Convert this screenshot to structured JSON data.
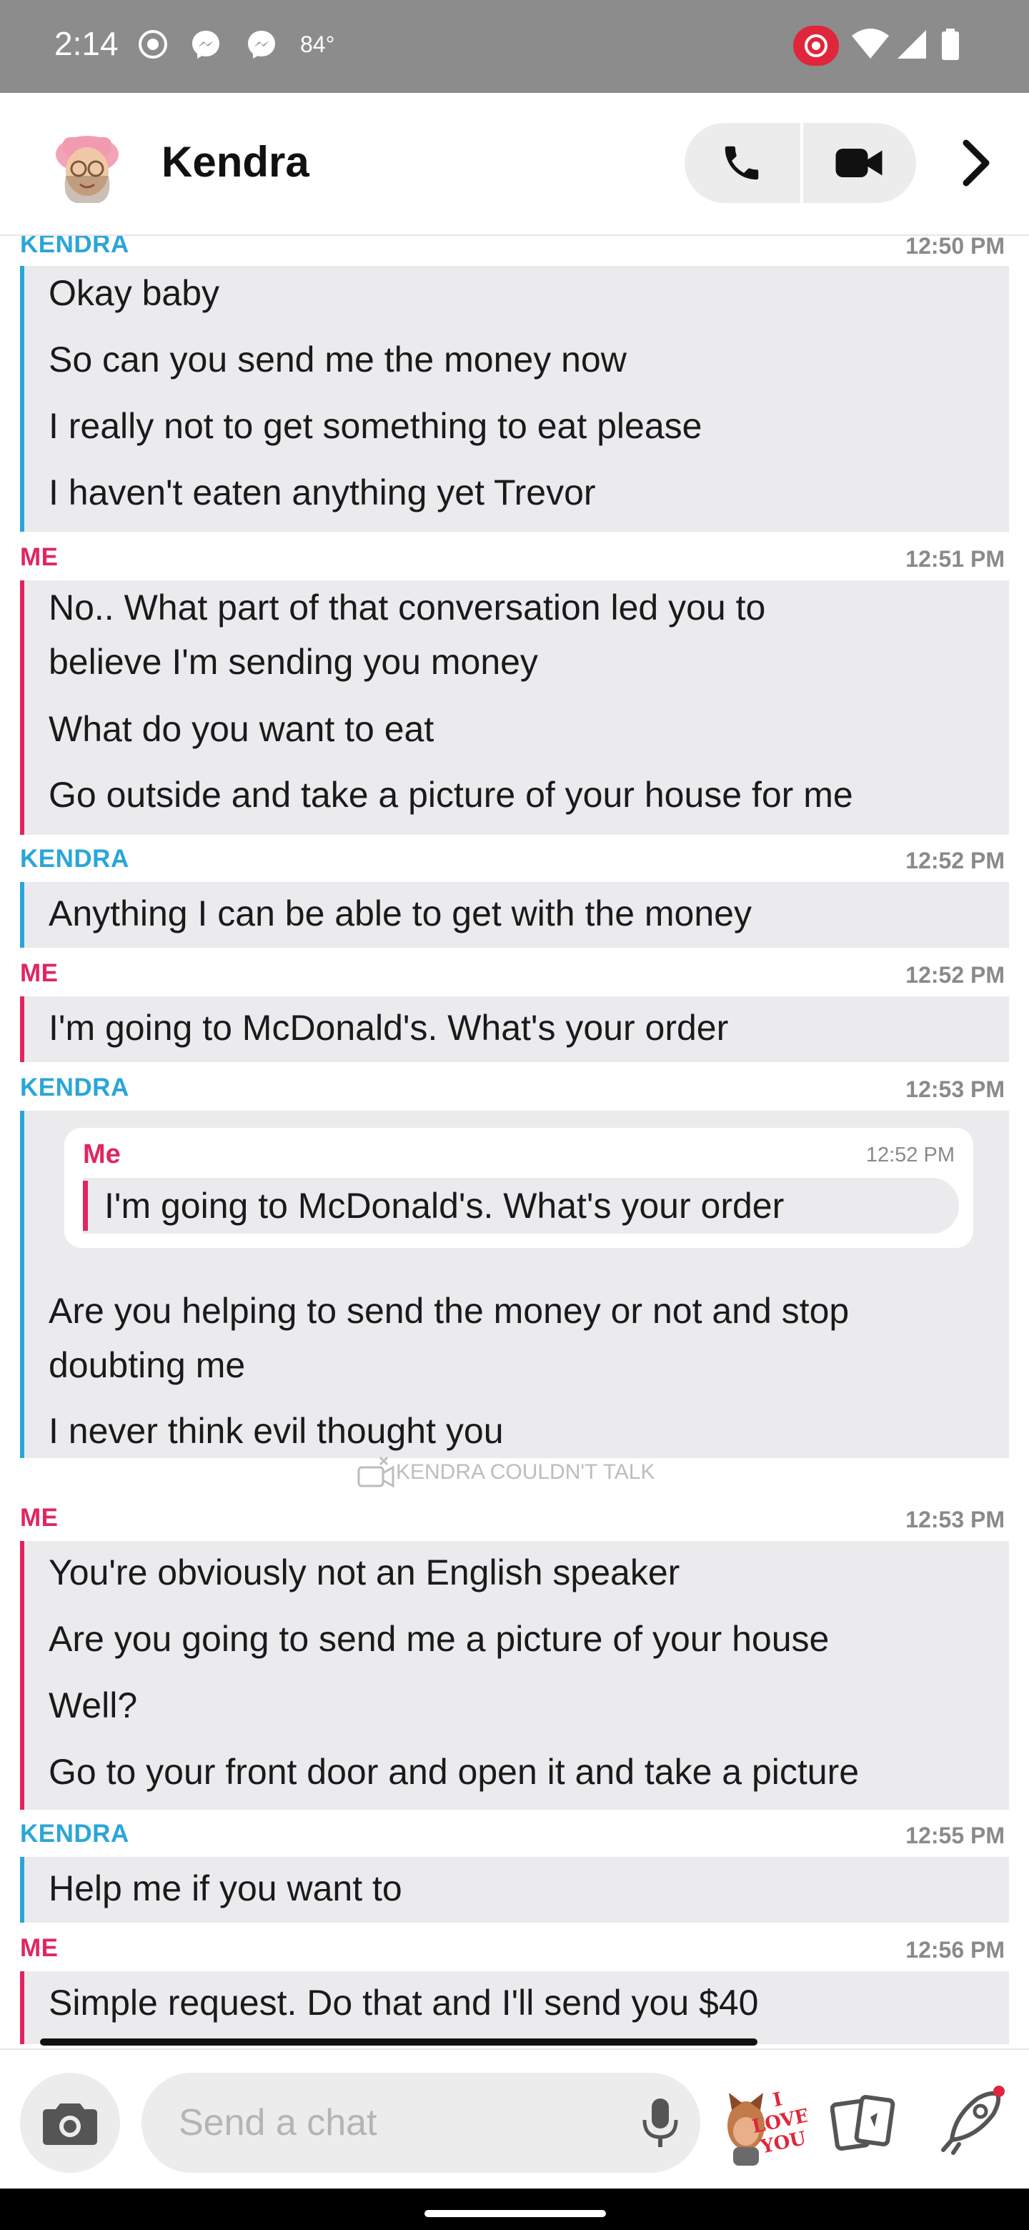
{
  "status_bar": {
    "time": "2:14",
    "temperature": "84°"
  },
  "header": {
    "contact_name": "Kendra"
  },
  "conversation": [
    {
      "sender": "KENDRA",
      "time": "12:50 PM",
      "messages": [
        "Okay baby",
        "So can you send me the money now",
        "I really not to get something to eat please",
        "I haven't eaten anything yet Trevor"
      ]
    },
    {
      "sender": "ME",
      "time": "12:51 PM",
      "messages": [
        "No.. What part of that conversation led you to",
        "believe I'm sending you money",
        "What do you want to eat",
        "Go outside and take a picture of your house for me"
      ]
    },
    {
      "sender": "KENDRA",
      "time": "12:52 PM",
      "messages": [
        "Anything I can be able to get with the money"
      ]
    },
    {
      "sender": "ME",
      "time": "12:52 PM",
      "messages": [
        "I'm going to McDonald's. What's your order"
      ]
    },
    {
      "sender": "KENDRA",
      "time": "12:53 PM",
      "quote": {
        "sender": "Me",
        "time": "12:52 PM",
        "text": "I'm going to McDonald's. What's your order"
      },
      "messages": [
        "Are you helping to send the money or not and stop",
        "doubting me",
        "I never think evil thought you"
      ]
    },
    {
      "sender": "ME",
      "time": "12:53 PM",
      "messages": [
        "You're obviously not an English speaker",
        "Are you going to send me a picture of your house",
        "Well?",
        "Go to your front door and open it and take a picture"
      ]
    },
    {
      "sender": "KENDRA",
      "time": "12:55 PM",
      "messages": [
        "Help me if you want to"
      ]
    },
    {
      "sender": "ME",
      "time": "12:56 PM",
      "messages": [
        "Simple request. Do that and I'll send you $40"
      ]
    }
  ],
  "missed_call_text": "KENDRA COULDN'T TALK",
  "composer": {
    "placeholder": "Send a chat"
  },
  "colors": {
    "kendra": "#2aa6d8",
    "me": "#e0265e",
    "bubble_bg": "#ebebee"
  },
  "icons": [
    "screen-record-icon",
    "messenger-icon",
    "recording-indicator-icon",
    "wifi-icon",
    "signal-icon",
    "battery-icon",
    "phone-icon",
    "video-icon",
    "chevron-right-icon",
    "camera-icon",
    "mic-icon",
    "cards-icon",
    "rocket-icon"
  ],
  "sticker_text": "I LOVE YOU"
}
